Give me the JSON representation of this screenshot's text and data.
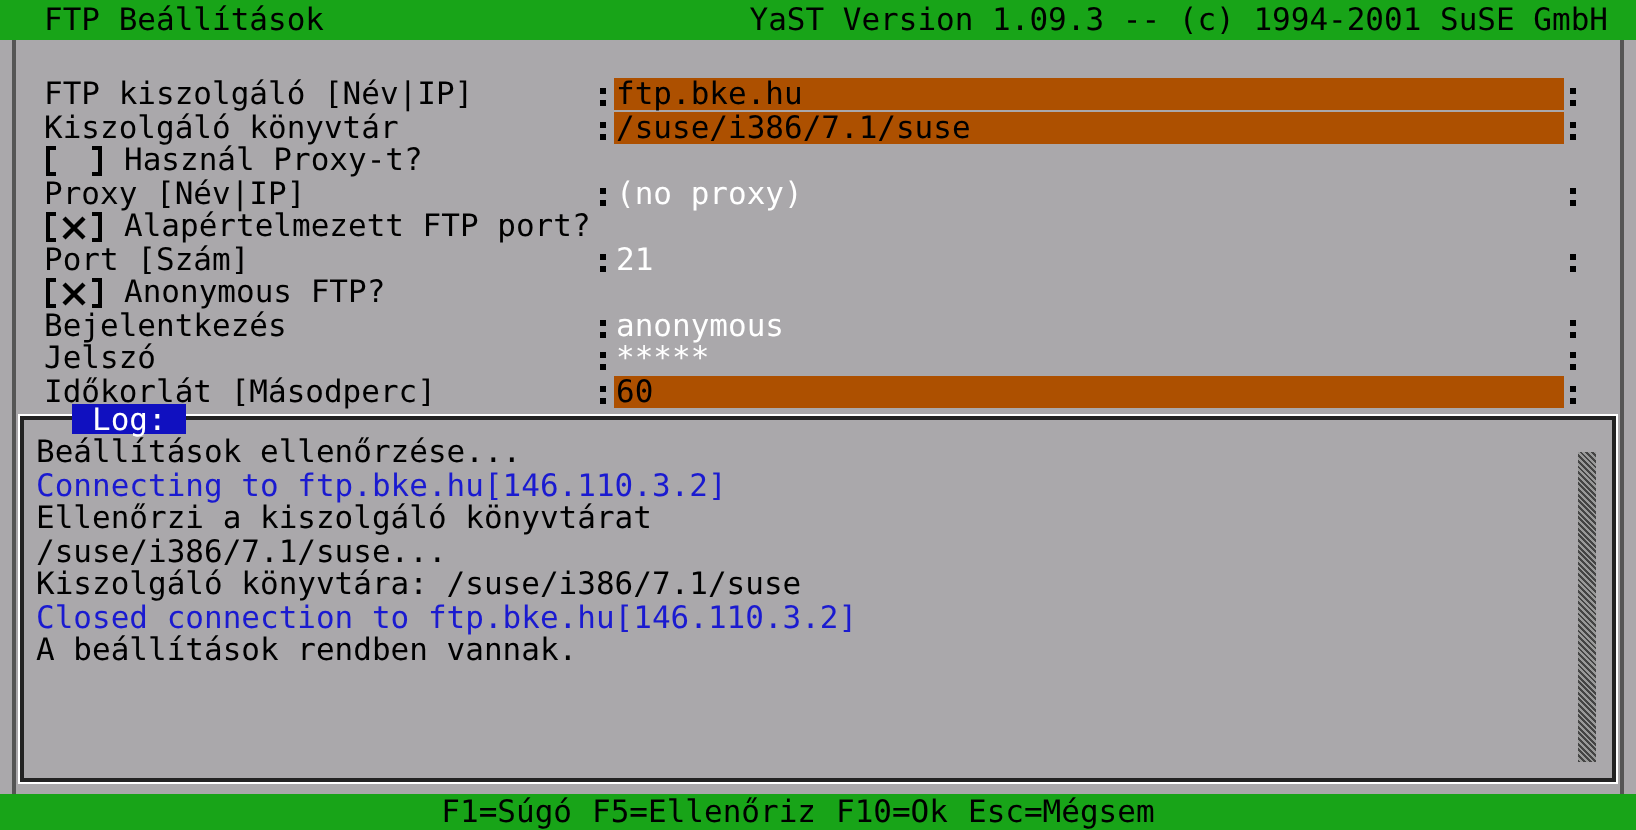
{
  "window": {
    "title": "FTP Beállítások",
    "version": "YaST Version 1.09.3 -- (c) 1994-2001 SuSE GmbH"
  },
  "form": [
    {
      "kind": "field",
      "label": "FTP kiszolgáló [Név|IP]",
      "value": "ftp.bke.hu",
      "disabled": false
    },
    {
      "kind": "field",
      "label": "Kiszolgáló könyvtár",
      "value": "/suse/i386/7.1/suse",
      "disabled": false
    },
    {
      "kind": "checkbox",
      "label": "Használ Proxy-t?",
      "checked": false
    },
    {
      "kind": "field",
      "label": "Proxy [Név|IP]",
      "value": "(no proxy)",
      "disabled": true
    },
    {
      "kind": "checkbox",
      "label": "Alapértelmezett FTP port?",
      "checked": true
    },
    {
      "kind": "field",
      "label": "Port [Szám]",
      "value": "21",
      "disabled": true
    },
    {
      "kind": "checkbox",
      "label": "Anonymous FTP?",
      "checked": true
    },
    {
      "kind": "field",
      "label": "Bejelentkezés",
      "value": "anonymous",
      "disabled": true
    },
    {
      "kind": "field",
      "label": "Jelszó",
      "value": "*****",
      "disabled": true
    },
    {
      "kind": "field",
      "label": "Időkorlát [Másodperc]",
      "value": "60",
      "disabled": false
    }
  ],
  "log": {
    "title": "Log:",
    "lines": [
      {
        "text": "Beállítások ellenőrzése...",
        "color": "#000000"
      },
      {
        "text": "Connecting to ftp.bke.hu[146.110.3.2]",
        "color": "#1a1ad0"
      },
      {
        "text": "Ellenőrzi a kiszolgáló könyvtárat",
        "color": "#000000"
      },
      {
        "text": "/suse/i386/7.1/suse...",
        "color": "#000000"
      },
      {
        "text": "Kiszolgáló könyvtára: /suse/i386/7.1/suse",
        "color": "#000000"
      },
      {
        "text": "Closed connection to ftp.bke.hu[146.110.3.2]",
        "color": "#1a1ad0"
      },
      {
        "text": "A beállítások rendben vannak.",
        "color": "#000000"
      }
    ]
  },
  "status_bar": {
    "keys": [
      "F1=Súgó",
      "F5=Ellenőriz",
      "F10=Ok",
      "Esc=Mégsem"
    ]
  }
}
